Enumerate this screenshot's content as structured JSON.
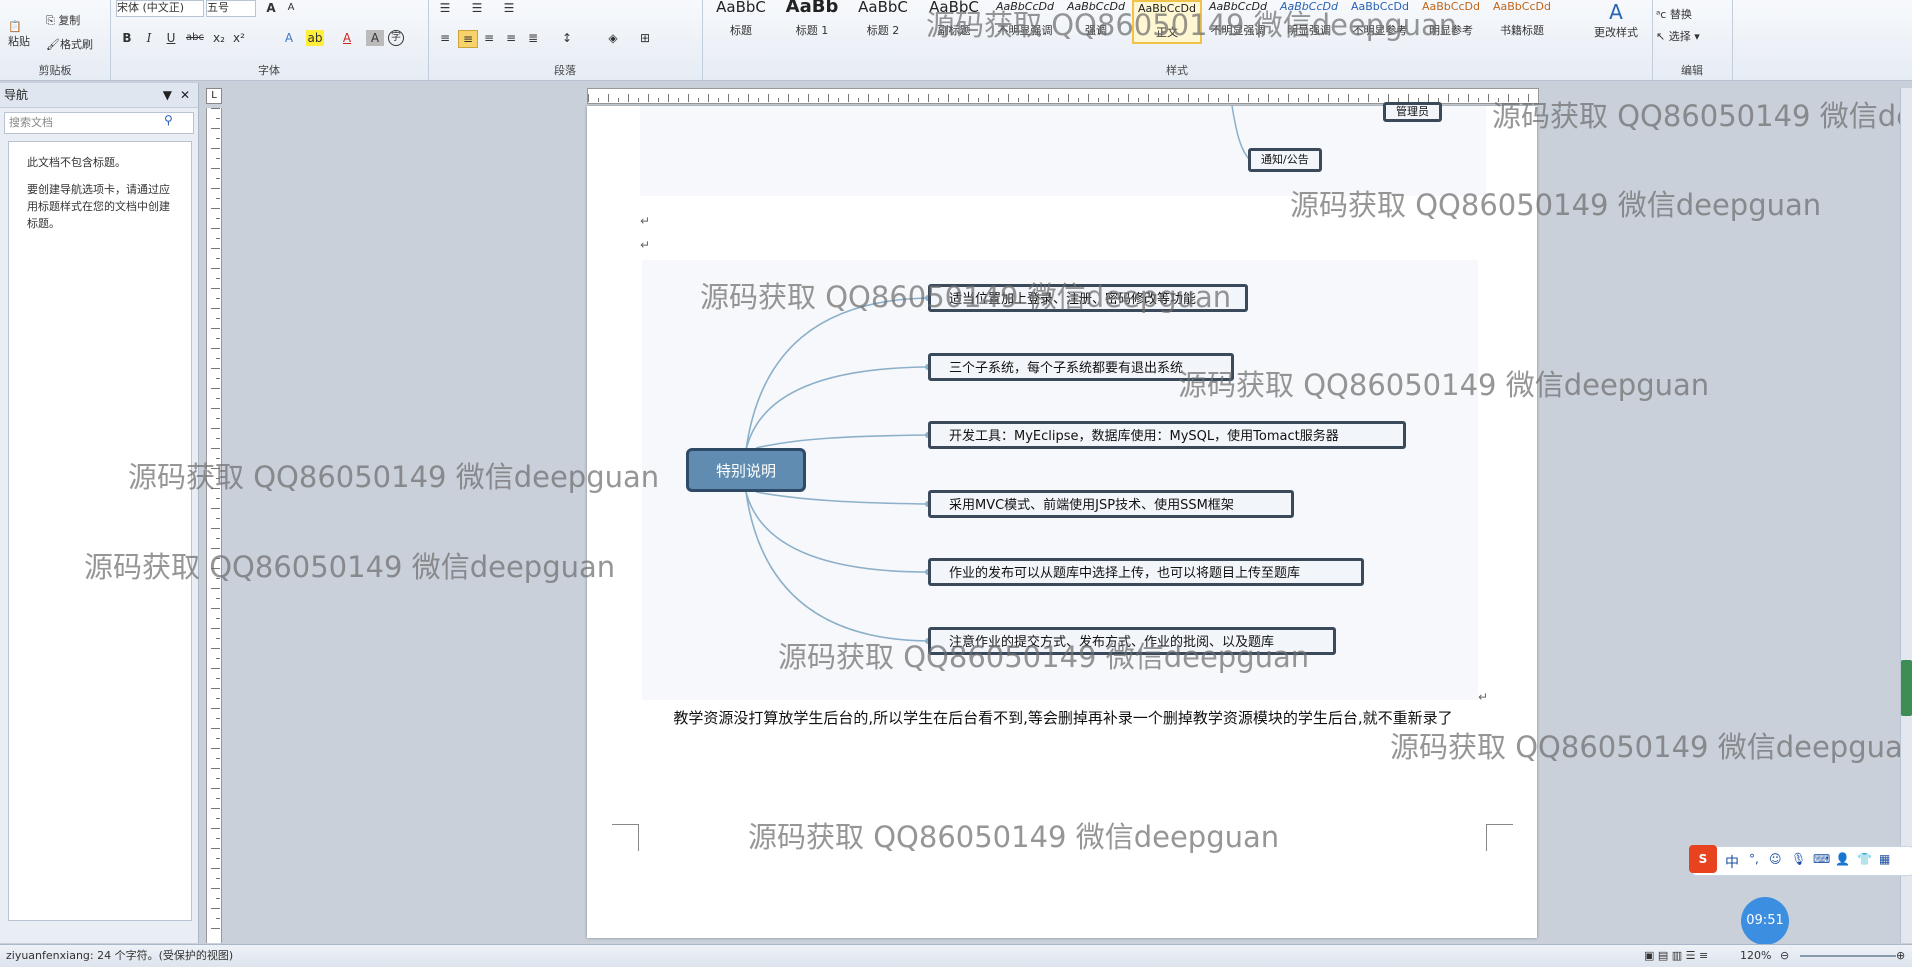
{
  "ribbon": {
    "clipboard": {
      "paste": "粘贴",
      "copy": "复制",
      "format_painter": "格式刷",
      "label": "剪贴板"
    },
    "font": {
      "name": "宋体 (中文正)",
      "size": "五号",
      "label": "字体"
    },
    "paragraph": {
      "label": "段落"
    },
    "styles": {
      "label": "样式",
      "cards": [
        {
          "sample": "AaBbC",
          "name": "标题"
        },
        {
          "sample": "AaBb",
          "name": "标题 1"
        },
        {
          "sample": "AaBbC",
          "name": "标题 2"
        },
        {
          "sample": "AaBbC",
          "name": "副标题"
        },
        {
          "sample": "AaBbCcDd",
          "name": "不明显强调"
        },
        {
          "sample": "AaBbCcDd",
          "name": "强调"
        },
        {
          "sample": "AaBbCcDd",
          "name": "正文"
        },
        {
          "sample": "AaBbCcDd",
          "name": "不明显强调"
        },
        {
          "sample": "AaBbCcDd",
          "name": "明显强调"
        },
        {
          "sample": "AaBbCcDd",
          "name": "不明显参考"
        },
        {
          "sample": "AaBbCcDd",
          "name": "明显参考"
        },
        {
          "sample": "AaBbCcDd",
          "name": "书籍标题"
        }
      ],
      "change_styles": "更改样式"
    },
    "editing": {
      "replace": "替换",
      "select": "选择",
      "label": "编辑"
    }
  },
  "nav": {
    "title": "导航",
    "search_placeholder": "搜索文档",
    "msg1": "此文档不包含标题。",
    "msg2": "要创建导航选项卡，请通过应用标题样式在您的文档中创建标题。"
  },
  "doc": {
    "top_nodes": [
      "管理员",
      "通知/公告"
    ],
    "root": "特别说明",
    "branches": [
      "适当位置加上登录、注册、密码修改等功能",
      "三个子系统，每个子系统都要有退出系统",
      "开发工具：MyEclipse，数据库使用：MySQL，使用Tomact服务器",
      "采用MVC模式、前端使用JSP技术、使用SSM框架",
      "作业的发布可以从题库中选择上传，也可以将题目上传至题库",
      "注意作业的提交方式、发布方式、作业的批阅、以及题库"
    ],
    "text": "教学资源没打算放学生后台的,所以学生在后台看不到,等会删掉再补录一个删掉教学资源模块的学生后台,就不重新录了"
  },
  "watermark": "源码获取 QQ86050149 微信deepguan",
  "status": {
    "left": "ziyuanfenxiang: 24 个字符。(受保护的视图)",
    "zoom": "120%"
  },
  "ime": {
    "mode": "中"
  },
  "clock": "09:51"
}
